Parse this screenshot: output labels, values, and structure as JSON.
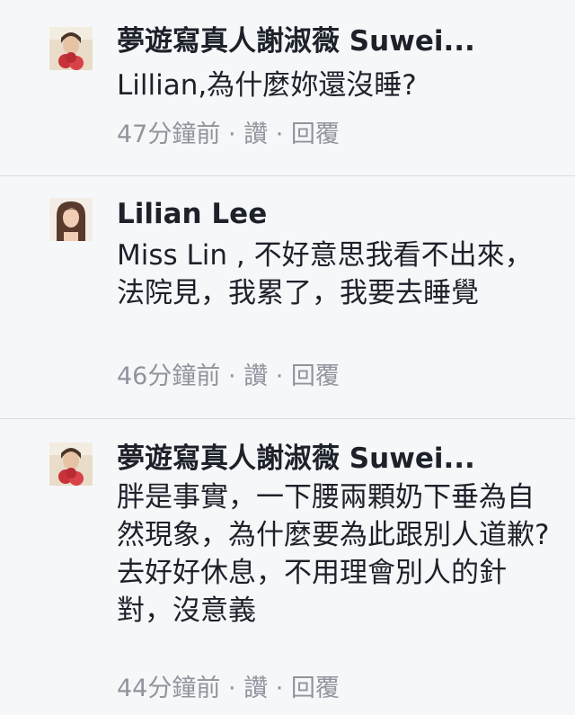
{
  "comments": [
    {
      "author": "夢遊寫真人謝淑薇 Suwei...",
      "text": "Lillian,為什麼妳還沒睡?",
      "time": "47分鐘前",
      "sep": "·",
      "like": "讚",
      "reply": "回覆"
    },
    {
      "author": "Lilian Lee",
      "text": "Miss Lin , 不好意思我看不出來，法院見，我累了，我要去睡覺",
      "time": "46分鐘前",
      "sep": "·",
      "like": "讚",
      "reply": "回覆"
    },
    {
      "author": "夢遊寫真人謝淑薇 Suwei...",
      "text": "胖是事實，一下腰兩顆奶下垂為自然現象，為什麼要為此跟別人道歉? 去好好休息，不用理會別人的針對，沒意義",
      "time": "44分鐘前",
      "sep": "·",
      "like": "讚",
      "reply": "回覆"
    }
  ]
}
